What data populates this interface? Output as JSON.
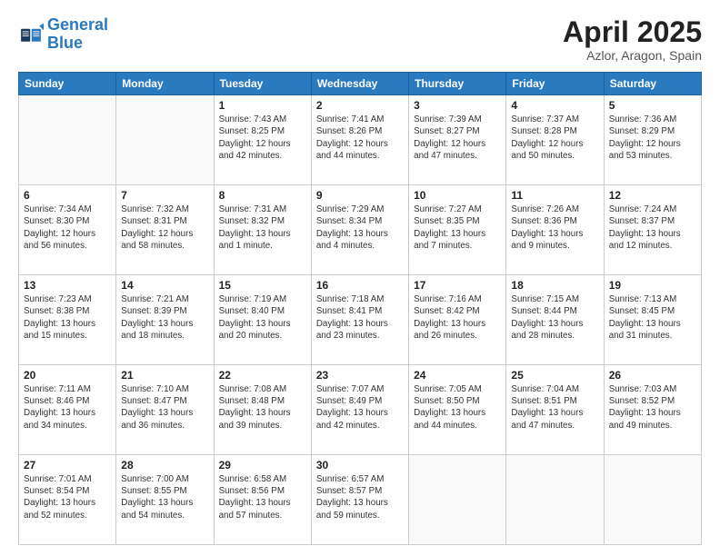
{
  "logo": {
    "line1": "General",
    "line2": "Blue"
  },
  "title": "April 2025",
  "subtitle": "Azlor, Aragon, Spain",
  "days_of_week": [
    "Sunday",
    "Monday",
    "Tuesday",
    "Wednesday",
    "Thursday",
    "Friday",
    "Saturday"
  ],
  "weeks": [
    [
      {
        "day": "",
        "info": ""
      },
      {
        "day": "",
        "info": ""
      },
      {
        "day": "1",
        "info": "Sunrise: 7:43 AM\nSunset: 8:25 PM\nDaylight: 12 hours and 42 minutes."
      },
      {
        "day": "2",
        "info": "Sunrise: 7:41 AM\nSunset: 8:26 PM\nDaylight: 12 hours and 44 minutes."
      },
      {
        "day": "3",
        "info": "Sunrise: 7:39 AM\nSunset: 8:27 PM\nDaylight: 12 hours and 47 minutes."
      },
      {
        "day": "4",
        "info": "Sunrise: 7:37 AM\nSunset: 8:28 PM\nDaylight: 12 hours and 50 minutes."
      },
      {
        "day": "5",
        "info": "Sunrise: 7:36 AM\nSunset: 8:29 PM\nDaylight: 12 hours and 53 minutes."
      }
    ],
    [
      {
        "day": "6",
        "info": "Sunrise: 7:34 AM\nSunset: 8:30 PM\nDaylight: 12 hours and 56 minutes."
      },
      {
        "day": "7",
        "info": "Sunrise: 7:32 AM\nSunset: 8:31 PM\nDaylight: 12 hours and 58 minutes."
      },
      {
        "day": "8",
        "info": "Sunrise: 7:31 AM\nSunset: 8:32 PM\nDaylight: 13 hours and 1 minute."
      },
      {
        "day": "9",
        "info": "Sunrise: 7:29 AM\nSunset: 8:34 PM\nDaylight: 13 hours and 4 minutes."
      },
      {
        "day": "10",
        "info": "Sunrise: 7:27 AM\nSunset: 8:35 PM\nDaylight: 13 hours and 7 minutes."
      },
      {
        "day": "11",
        "info": "Sunrise: 7:26 AM\nSunset: 8:36 PM\nDaylight: 13 hours and 9 minutes."
      },
      {
        "day": "12",
        "info": "Sunrise: 7:24 AM\nSunset: 8:37 PM\nDaylight: 13 hours and 12 minutes."
      }
    ],
    [
      {
        "day": "13",
        "info": "Sunrise: 7:23 AM\nSunset: 8:38 PM\nDaylight: 13 hours and 15 minutes."
      },
      {
        "day": "14",
        "info": "Sunrise: 7:21 AM\nSunset: 8:39 PM\nDaylight: 13 hours and 18 minutes."
      },
      {
        "day": "15",
        "info": "Sunrise: 7:19 AM\nSunset: 8:40 PM\nDaylight: 13 hours and 20 minutes."
      },
      {
        "day": "16",
        "info": "Sunrise: 7:18 AM\nSunset: 8:41 PM\nDaylight: 13 hours and 23 minutes."
      },
      {
        "day": "17",
        "info": "Sunrise: 7:16 AM\nSunset: 8:42 PM\nDaylight: 13 hours and 26 minutes."
      },
      {
        "day": "18",
        "info": "Sunrise: 7:15 AM\nSunset: 8:44 PM\nDaylight: 13 hours and 28 minutes."
      },
      {
        "day": "19",
        "info": "Sunrise: 7:13 AM\nSunset: 8:45 PM\nDaylight: 13 hours and 31 minutes."
      }
    ],
    [
      {
        "day": "20",
        "info": "Sunrise: 7:11 AM\nSunset: 8:46 PM\nDaylight: 13 hours and 34 minutes."
      },
      {
        "day": "21",
        "info": "Sunrise: 7:10 AM\nSunset: 8:47 PM\nDaylight: 13 hours and 36 minutes."
      },
      {
        "day": "22",
        "info": "Sunrise: 7:08 AM\nSunset: 8:48 PM\nDaylight: 13 hours and 39 minutes."
      },
      {
        "day": "23",
        "info": "Sunrise: 7:07 AM\nSunset: 8:49 PM\nDaylight: 13 hours and 42 minutes."
      },
      {
        "day": "24",
        "info": "Sunrise: 7:05 AM\nSunset: 8:50 PM\nDaylight: 13 hours and 44 minutes."
      },
      {
        "day": "25",
        "info": "Sunrise: 7:04 AM\nSunset: 8:51 PM\nDaylight: 13 hours and 47 minutes."
      },
      {
        "day": "26",
        "info": "Sunrise: 7:03 AM\nSunset: 8:52 PM\nDaylight: 13 hours and 49 minutes."
      }
    ],
    [
      {
        "day": "27",
        "info": "Sunrise: 7:01 AM\nSunset: 8:54 PM\nDaylight: 13 hours and 52 minutes."
      },
      {
        "day": "28",
        "info": "Sunrise: 7:00 AM\nSunset: 8:55 PM\nDaylight: 13 hours and 54 minutes."
      },
      {
        "day": "29",
        "info": "Sunrise: 6:58 AM\nSunset: 8:56 PM\nDaylight: 13 hours and 57 minutes."
      },
      {
        "day": "30",
        "info": "Sunrise: 6:57 AM\nSunset: 8:57 PM\nDaylight: 13 hours and 59 minutes."
      },
      {
        "day": "",
        "info": ""
      },
      {
        "day": "",
        "info": ""
      },
      {
        "day": "",
        "info": ""
      }
    ]
  ]
}
